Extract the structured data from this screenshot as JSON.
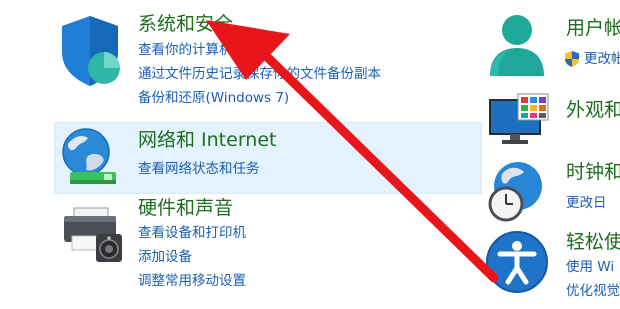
{
  "left_categories": [
    {
      "title": "系统和安全",
      "icon": "shield-icon",
      "links": [
        "查看你的计算机状态",
        "通过文件历史记录保存你的文件备份副本",
        "备份和还原(Windows 7)"
      ]
    },
    {
      "title": "网络和 Internet",
      "icon": "network-globe-icon",
      "links": [
        "查看网络状态和任务"
      ]
    },
    {
      "title": "硬件和声音",
      "icon": "printer-icon",
      "links": [
        "查看设备和打印机",
        "添加设备",
        "调整常用移动设置"
      ]
    }
  ],
  "right_categories": [
    {
      "title": "用户帐",
      "icon": "user-accounts-icon",
      "links": [
        "更改帐"
      ]
    },
    {
      "title": "外观和",
      "icon": "appearance-monitor-icon",
      "links": []
    },
    {
      "title": "时钟和",
      "icon": "clock-globe-icon",
      "links": [
        "更改日"
      ]
    },
    {
      "title": "轻松使",
      "icon": "accessibility-icon",
      "links": [
        "使用 Wi",
        "优化视觉"
      ]
    }
  ],
  "colors": {
    "title_green": "#1e6e1e",
    "link_blue": "#1a5fb4",
    "highlight": "#e3f2fc",
    "annotation_arrow": "#e8151b"
  }
}
